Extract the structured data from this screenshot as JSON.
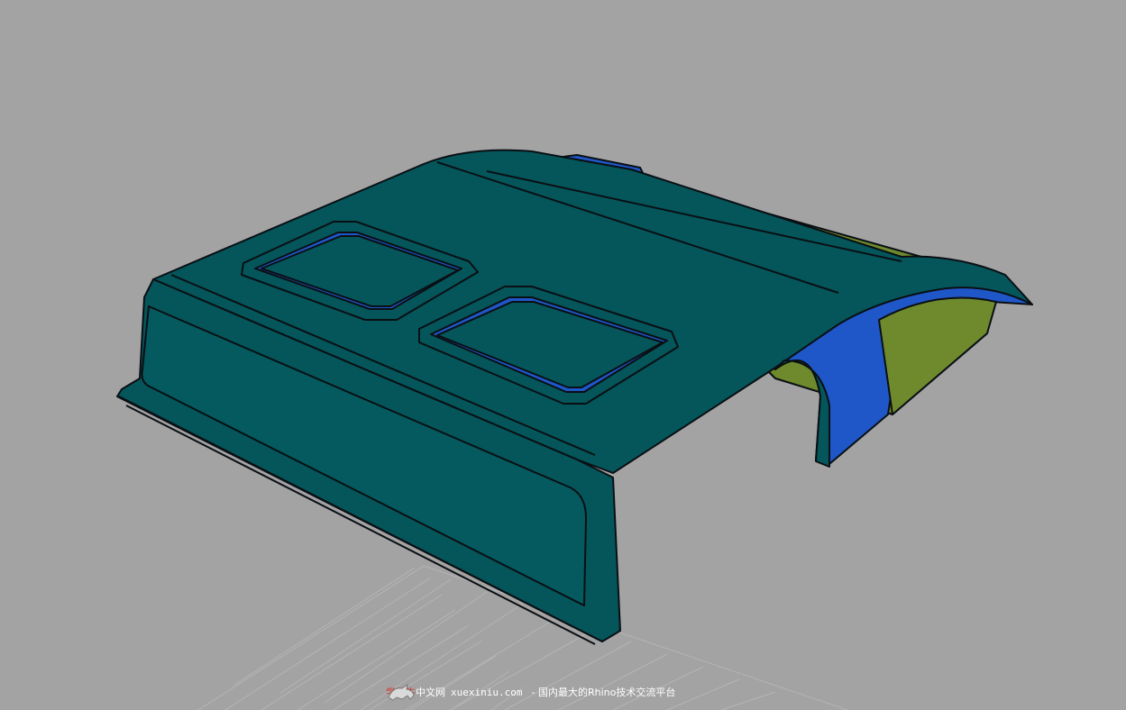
{
  "viewport": {
    "background_color": "#a3a3a3",
    "grid_color": "#b5b5b5",
    "model_colors": {
      "shell_teal": "#04565a",
      "shell_teal_light": "#0a6a6c",
      "edge_blue": "#1f57c8",
      "interior_green": "#6e8a2c",
      "outline": "#0a0f14"
    }
  },
  "watermark": {
    "logo_icon": "rhino-icon",
    "brand_red": "学犀牛",
    "brand_white": "中文网",
    "url": "xuexiniu.com",
    "tagline": "- 国内最大的Rhino技术交流平台"
  }
}
